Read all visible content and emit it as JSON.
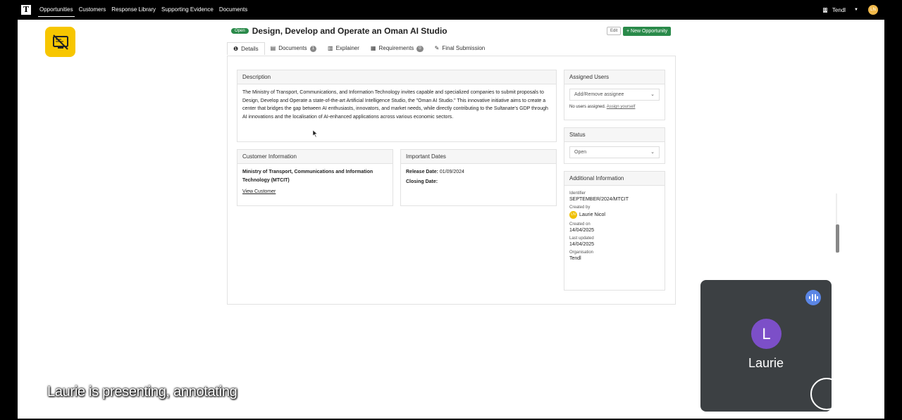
{
  "nav": {
    "logo": "T",
    "items": [
      "Opportunities",
      "Customers",
      "Response Library",
      "Supporting Evidence",
      "Documents"
    ],
    "org": "Tendl",
    "user_initials": "LN"
  },
  "opportunity": {
    "status_badge": "Open",
    "title": "Design, Develop and Operate an Oman AI Studio",
    "edit_label": "Edit",
    "new_label": "+ New Opportunity"
  },
  "tabs": [
    {
      "label": "Details",
      "icon": "info-icon"
    },
    {
      "label": "Documents",
      "icon": "document-icon",
      "count": "1"
    },
    {
      "label": "Explainer",
      "icon": "book-icon"
    },
    {
      "label": "Requirements",
      "icon": "clipboard-icon",
      "count": "0"
    },
    {
      "label": "Final Submission",
      "icon": "edit-icon"
    }
  ],
  "description": {
    "heading": "Description",
    "text": "The Ministry of Transport, Communications, and Information Technology invites capable and specialized companies to submit proposals to Design, Develop and Operate a state-of-the-art Artificial Intelligence Studio, the \"Oman AI Studio.\" This innovative initiative aims to create a center that bridges the gap between AI enthusiasts, innovators, and market needs, while directly contributing to the Sultanate's GDP through AI innovations and the localisation of AI-enhanced applications across various economic sectors."
  },
  "customer": {
    "heading": "Customer Information",
    "name": "Ministry of Transport, Communications and Information Technology (MTCIT)",
    "link": "View Customer"
  },
  "dates": {
    "heading": "Important Dates",
    "release_label": "Release Date:",
    "release_value": "01/09/2024",
    "closing_label": "Closing Date:"
  },
  "assigned": {
    "heading": "Assigned Users",
    "placeholder": "Add/Remove assignee",
    "none_text": "No users assigned.",
    "assign_link": "Assign yourself"
  },
  "status": {
    "heading": "Status",
    "value": "Open"
  },
  "additional": {
    "heading": "Additional Information",
    "identifier_label": "Identifier",
    "identifier": "SEPTEMBER/2024/MTCIT",
    "created_by_label": "Created by",
    "creator_initials": "LN",
    "creator": "Laurie Nicol",
    "created_on_label": "Created on",
    "created_on": "14/04/2025",
    "updated_label": "Last updated",
    "updated": "14/04/2025",
    "org_label": "Organisation",
    "org": "Tendl"
  },
  "meeting": {
    "caption": "Laurie is presenting, annotating",
    "participant_initial": "L",
    "participant_name": "Laurie"
  },
  "colors": {
    "accent_green": "#2a8a4a",
    "presenter_yellow": "#f7c600",
    "avatar_purple": "#7c4fc8",
    "tile_bg": "#3c4043"
  }
}
